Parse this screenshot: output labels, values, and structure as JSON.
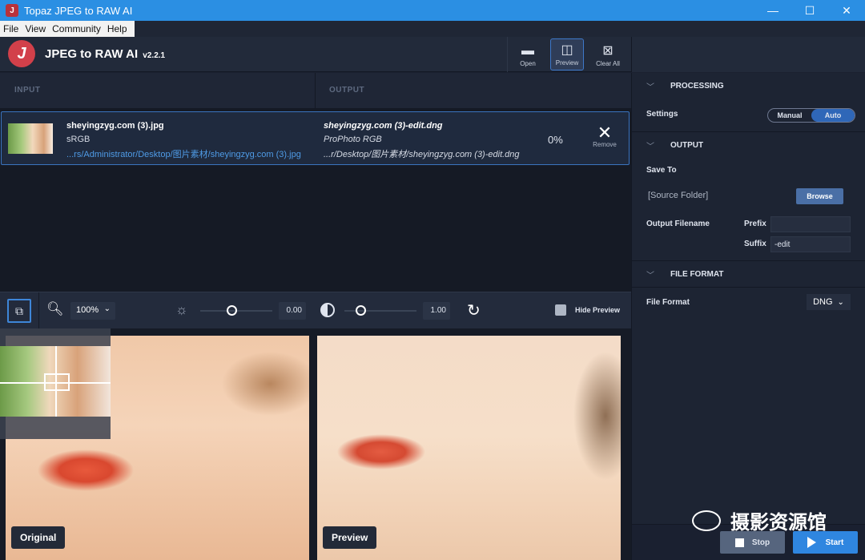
{
  "window": {
    "title": "Topaz JPEG to RAW AI",
    "minimize": "—",
    "maximize": "☐",
    "close": "✕"
  },
  "menu": {
    "items": [
      "File",
      "View",
      "Community",
      "Help"
    ]
  },
  "header": {
    "logo_letter": "J",
    "app_name": "JPEG to RAW AI",
    "version": "v2.2.1",
    "tools": [
      {
        "label": "Open",
        "icon": "folder-icon"
      },
      {
        "label": "Preview",
        "icon": "split-view-icon",
        "active": true
      },
      {
        "label": "Clear All",
        "icon": "clear-all-icon"
      }
    ]
  },
  "columns": {
    "input": "INPUT",
    "output": "OUTPUT"
  },
  "file": {
    "input_name": "sheyingzyg.com (3).jpg",
    "input_space": "sRGB",
    "input_path": "...rs/Administrator/Desktop/图片素材/sheyingzyg.com (3).jpg",
    "output_name": "sheyingzyg.com (3)-edit.dng",
    "output_space": "ProPhoto RGB",
    "output_path": "...r/Desktop/图片素材/sheyingzyg.com (3)-edit.dng",
    "progress": "0%",
    "remove_label": "Remove"
  },
  "preview_toolbar": {
    "zoom": "100%",
    "exposure_value": "0.00",
    "contrast_value": "1.00",
    "hide_preview": "Hide Preview"
  },
  "preview": {
    "original_label": "Original",
    "preview_label": "Preview"
  },
  "panel": {
    "processing_title": "PROCESSING",
    "settings_label": "Settings",
    "settings_options": [
      "Manual",
      "Auto"
    ],
    "settings_selected": "Auto",
    "output_title": "OUTPUT",
    "save_to_label": "Save To",
    "save_to_value": "[Source Folder]",
    "browse_label": "Browse",
    "output_filename_label": "Output Filename",
    "prefix_label": "Prefix",
    "prefix_value": "",
    "suffix_label": "Suffix",
    "suffix_value": "-edit",
    "file_format_title": "FILE FORMAT",
    "file_format_label": "File Format",
    "file_format_value": "DNG",
    "stop_label": "Stop",
    "start_label": "Start"
  },
  "watermark": "摄影资源馆",
  "colors": {
    "accent": "#2f86e0",
    "titlebar": "#2b8fe3",
    "logo": "#d2404a",
    "path_link": "#4f9be6"
  }
}
